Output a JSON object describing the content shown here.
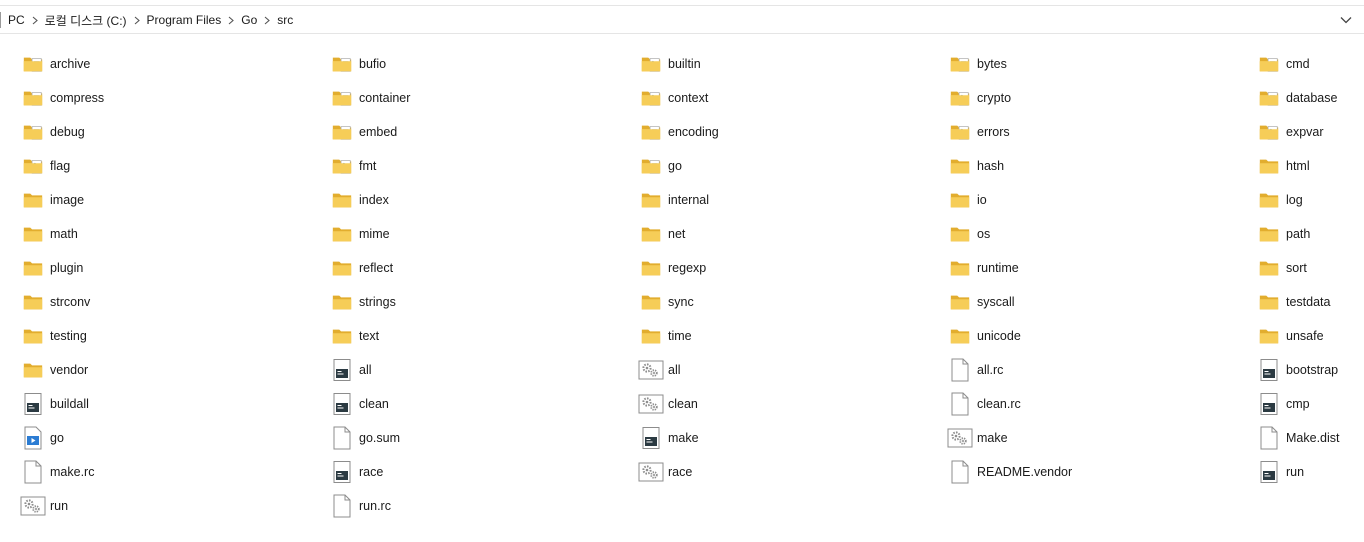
{
  "breadcrumb": [
    "PC",
    "로컬 디스크 (C:)",
    "Program Files",
    "Go",
    "src"
  ],
  "colors": {
    "folder": "#f6cd58",
    "folder_dark": "#e2ad2e",
    "doc_border": "#8c8c8c",
    "console_dark": "#2b3a42",
    "accent_blue": "#2b7cd3"
  },
  "items": [
    {
      "name": "archive",
      "icon": "folder-doc-icon"
    },
    {
      "name": "bufio",
      "icon": "folder-doc-icon"
    },
    {
      "name": "builtin",
      "icon": "folder-go-icon"
    },
    {
      "name": "bytes",
      "icon": "folder-doc-icon"
    },
    {
      "name": "cmd",
      "icon": "folder-doc-icon"
    },
    {
      "name": "compress",
      "icon": "folder-doc-icon"
    },
    {
      "name": "container",
      "icon": "folder-doc-icon"
    },
    {
      "name": "context",
      "icon": "folder-go-icon"
    },
    {
      "name": "crypto",
      "icon": "folder-go-icon"
    },
    {
      "name": "database",
      "icon": "folder-doc-icon"
    },
    {
      "name": "debug",
      "icon": "folder-doc-icon"
    },
    {
      "name": "embed",
      "icon": "folder-doc-icon"
    },
    {
      "name": "encoding",
      "icon": "folder-doc-icon"
    },
    {
      "name": "errors",
      "icon": "folder-go-icon"
    },
    {
      "name": "expvar",
      "icon": "folder-go-icon"
    },
    {
      "name": "flag",
      "icon": "folder-go-icon"
    },
    {
      "name": "fmt",
      "icon": "folder-go-icon"
    },
    {
      "name": "go",
      "icon": "folder-doc-icon"
    },
    {
      "name": "hash",
      "icon": "folder-icon"
    },
    {
      "name": "html",
      "icon": "folder-icon"
    },
    {
      "name": "image",
      "icon": "folder-icon"
    },
    {
      "name": "index",
      "icon": "folder-icon"
    },
    {
      "name": "internal",
      "icon": "folder-icon"
    },
    {
      "name": "io",
      "icon": "folder-icon"
    },
    {
      "name": "log",
      "icon": "folder-icon"
    },
    {
      "name": "math",
      "icon": "folder-icon"
    },
    {
      "name": "mime",
      "icon": "folder-icon"
    },
    {
      "name": "net",
      "icon": "folder-icon"
    },
    {
      "name": "os",
      "icon": "folder-icon"
    },
    {
      "name": "path",
      "icon": "folder-icon"
    },
    {
      "name": "plugin",
      "icon": "folder-icon"
    },
    {
      "name": "reflect",
      "icon": "folder-icon"
    },
    {
      "name": "regexp",
      "icon": "folder-icon"
    },
    {
      "name": "runtime",
      "icon": "folder-icon"
    },
    {
      "name": "sort",
      "icon": "folder-icon"
    },
    {
      "name": "strconv",
      "icon": "folder-icon"
    },
    {
      "name": "strings",
      "icon": "folder-icon"
    },
    {
      "name": "sync",
      "icon": "folder-icon"
    },
    {
      "name": "syscall",
      "icon": "folder-icon"
    },
    {
      "name": "testdata",
      "icon": "folder-icon"
    },
    {
      "name": "testing",
      "icon": "folder-icon"
    },
    {
      "name": "text",
      "icon": "folder-icon"
    },
    {
      "name": "time",
      "icon": "folder-icon"
    },
    {
      "name": "unicode",
      "icon": "folder-icon"
    },
    {
      "name": "unsafe",
      "icon": "folder-icon"
    },
    {
      "name": "vendor",
      "icon": "folder-icon"
    },
    {
      "name": "all",
      "icon": "console-file-icon"
    },
    {
      "name": "all",
      "icon": "settings-file-icon"
    },
    {
      "name": "all.rc",
      "icon": "blank-file-icon"
    },
    {
      "name": "bootstrap",
      "icon": "console-file-icon"
    },
    {
      "name": "buildall",
      "icon": "console-file-icon"
    },
    {
      "name": "clean",
      "icon": "console-file-icon"
    },
    {
      "name": "clean",
      "icon": "settings-file-icon"
    },
    {
      "name": "clean.rc",
      "icon": "blank-file-icon"
    },
    {
      "name": "cmp",
      "icon": "console-file-icon"
    },
    {
      "name": "go",
      "icon": "video-file-icon"
    },
    {
      "name": "go.sum",
      "icon": "blank-file-icon"
    },
    {
      "name": "make",
      "icon": "console-file-icon"
    },
    {
      "name": "make",
      "icon": "settings-file-icon"
    },
    {
      "name": "Make.dist",
      "icon": "blank-file-icon"
    },
    {
      "name": "make.rc",
      "icon": "blank-file-icon"
    },
    {
      "name": "race",
      "icon": "console-file-icon"
    },
    {
      "name": "race",
      "icon": "settings-file-icon"
    },
    {
      "name": "README.vendor",
      "icon": "blank-file-icon"
    },
    {
      "name": "run",
      "icon": "console-file-icon"
    },
    {
      "name": "run",
      "icon": "settings-file-icon"
    },
    {
      "name": "run.rc",
      "icon": "blank-file-icon"
    }
  ]
}
